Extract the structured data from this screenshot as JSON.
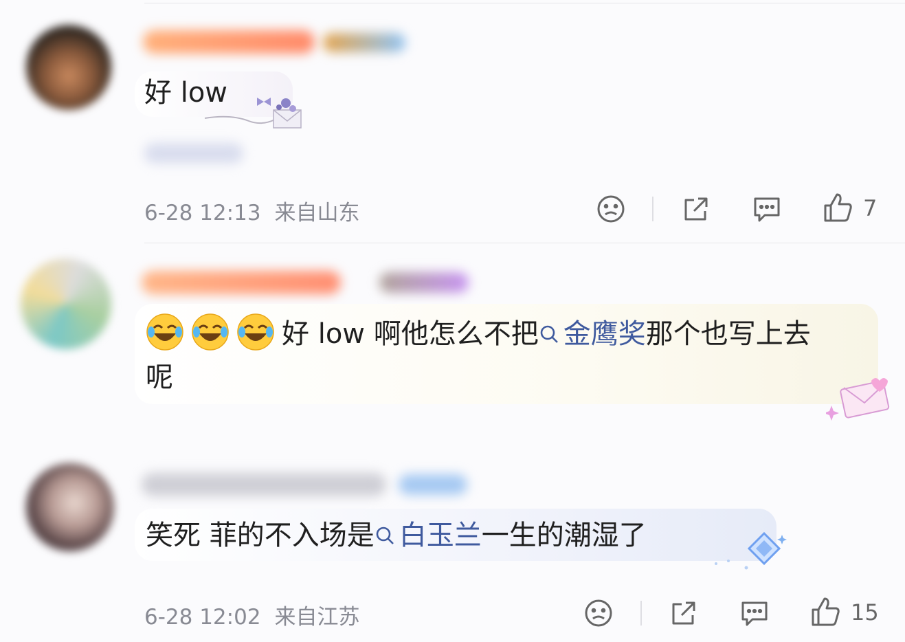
{
  "comments": [
    {
      "text": "好 low",
      "date": "6-28 12:13",
      "location": "来自山东",
      "likes": "7"
    },
    {
      "text_before": "好 low 啊他怎么不把",
      "topic": "金鹰奖",
      "text_after": "那个也写上去",
      "text_line2": "呢"
    },
    {
      "text_before": "笑死  菲的不入场是",
      "topic": "白玉兰",
      "text_after": "一生的潮湿了",
      "date": "6-28 12:02",
      "location": "来自江苏",
      "likes": "15"
    }
  ],
  "colors": {
    "topic_link": "#3f5a9e",
    "meta_text": "#888a93",
    "divider": "#e6e6ea"
  },
  "icons": [
    "sad-face-icon",
    "share-icon",
    "comment-icon",
    "thumbs-up-icon",
    "search-icon",
    "laughing-emoji-icon"
  ]
}
